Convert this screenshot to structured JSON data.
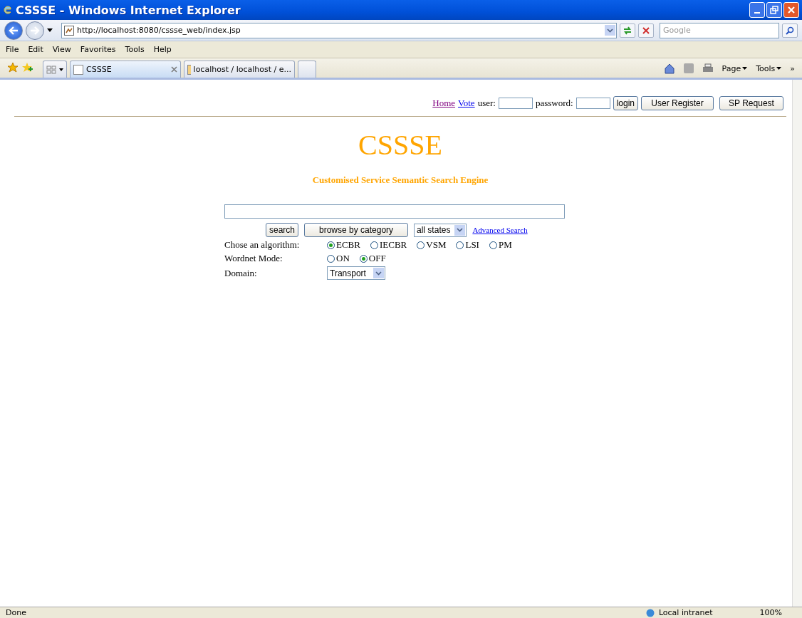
{
  "window": {
    "title": "CSSSE - Windows Internet Explorer"
  },
  "address_bar": {
    "url": "http://localhost:8080/cssse_web/index.jsp",
    "search_placeholder": "Google"
  },
  "menu": [
    "File",
    "Edit",
    "View",
    "Favorites",
    "Tools",
    "Help"
  ],
  "tabs": [
    {
      "label": "CSSSE",
      "selected": true
    },
    {
      "label": "localhost / localhost / e...",
      "selected": false
    }
  ],
  "command_bar": {
    "page": "Page",
    "tools": "Tools",
    "more": "»"
  },
  "page": {
    "links": [
      "Home",
      "Vote"
    ],
    "user_label": "user:",
    "password_label": "password:",
    "buttons": [
      "login",
      "User Register",
      "SP Request"
    ],
    "logo": "CSSSE",
    "subtitle": "Customised Service Semantic Search Engine",
    "search_button": "search",
    "browse_button": "browse by category",
    "states_select": "all states",
    "advanced_link": "Advanced Search",
    "algorithm": {
      "label": "Chose an algorithm:",
      "options": [
        {
          "label": "ECBR",
          "selected": true
        },
        {
          "label": "IECBR",
          "selected": false
        },
        {
          "label": "VSM",
          "selected": false
        },
        {
          "label": "LSI",
          "selected": false
        },
        {
          "label": "PM",
          "selected": false
        }
      ]
    },
    "wordnet": {
      "label": "Wordnet Mode:",
      "options": [
        {
          "label": "ON",
          "selected": false
        },
        {
          "label": "OFF",
          "selected": true
        }
      ]
    },
    "domain": {
      "label": "Domain:",
      "value": "Transport"
    }
  },
  "status_bar": {
    "status": "Done",
    "zone": "Local intranet",
    "zoom": "100%"
  }
}
